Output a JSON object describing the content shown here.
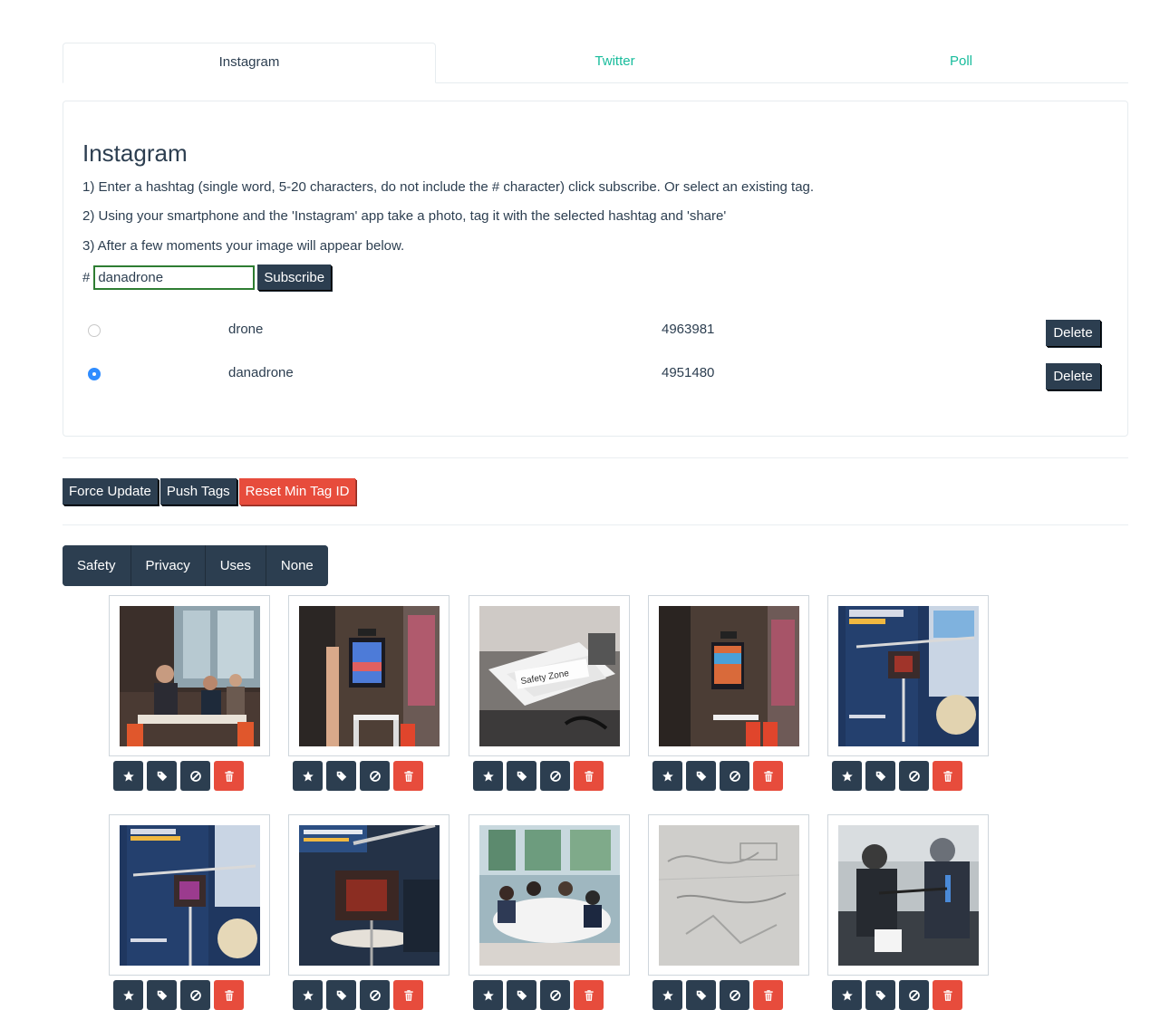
{
  "tabs": [
    {
      "label": "Instagram",
      "active": true
    },
    {
      "label": "Twitter",
      "active": false
    },
    {
      "label": "Poll",
      "active": false
    }
  ],
  "panel": {
    "title": "Instagram",
    "instructions": [
      "1) Enter a hashtag (single word, 5-20 characters, do not include the # character) click subscribe. Or select an existing tag.",
      "2) Using your smartphone and the 'Instagram' app take a photo, tag it with the selected hashtag and 'share'",
      "3) After a few moments your image will appear below."
    ],
    "hash_symbol": "#",
    "hashtag_value": "danadrone",
    "subscribe_label": "Subscribe",
    "tags": [
      {
        "name": "drone",
        "id": "4963981",
        "selected": false,
        "delete_label": "Delete"
      },
      {
        "name": "danadrone",
        "id": "4951480",
        "selected": true,
        "delete_label": "Delete"
      }
    ]
  },
  "actions": {
    "force_update": "Force Update",
    "push_tags": "Push Tags",
    "reset_min_tag_id": "Reset Min Tag ID"
  },
  "filters": [
    "Safety",
    "Privacy",
    "Uses",
    "None"
  ],
  "colors": {
    "primary": "#2c3e50",
    "accent": "#18bc9c",
    "danger": "#e74c3c",
    "radio_selected": "#2f8cff"
  },
  "images": [
    {
      "photo": "meeting-room",
      "safety_zone_label": ""
    },
    {
      "photo": "cafe-screen",
      "safety_zone_label": ""
    },
    {
      "photo": "safety-zone",
      "safety_zone_label": "Safety Zone"
    },
    {
      "photo": "cafe-screen-2",
      "safety_zone_label": ""
    },
    {
      "photo": "drone-poster",
      "safety_zone_label": ""
    },
    {
      "photo": "drone-poster-2",
      "safety_zone_label": ""
    },
    {
      "photo": "drone-closeup",
      "safety_zone_label": ""
    },
    {
      "photo": "workshop-table",
      "safety_zone_label": ""
    },
    {
      "photo": "paper-sketch",
      "safety_zone_label": ""
    },
    {
      "photo": "outdoor-people",
      "safety_zone_label": ""
    }
  ],
  "image_actions": [
    "star-icon",
    "tag-icon",
    "block-icon",
    "trash-icon"
  ]
}
